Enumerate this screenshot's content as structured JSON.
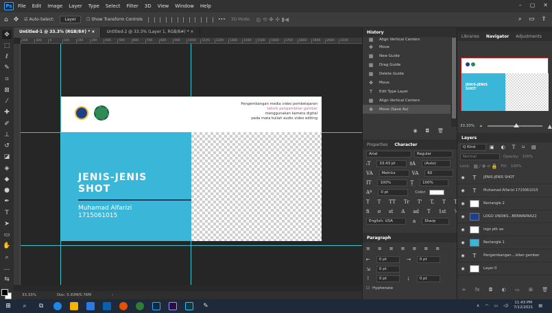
{
  "menubar": {
    "logo": "Ps",
    "items": [
      "File",
      "Edit",
      "Image",
      "Layer",
      "Type",
      "Select",
      "Filter",
      "3D",
      "View",
      "Window",
      "Help"
    ],
    "controls": [
      "–",
      "▢",
      "✕"
    ]
  },
  "options": {
    "auto_select_label": "Auto-Select:",
    "auto_select_value": "Layer",
    "transform_label": "Show Transform Controls",
    "mode_label": "3D Mode:"
  },
  "tabs": [
    {
      "label": "Untitled-1 @ 33.3% (RGB/8#) *",
      "close": "×"
    },
    {
      "label": "Untitled-2 @ 33.3% (Layer 1, RGB/8#) *",
      "close": "×"
    }
  ],
  "ruler_ticks": [
    "200",
    "300",
    "0",
    "100",
    "200",
    "300",
    "400",
    "500",
    "600",
    "700",
    "800",
    "900",
    "1000",
    "1100",
    "1200",
    "1300",
    "1400",
    "1500",
    "1600",
    "1700",
    "1800",
    "1900",
    "2000",
    "2100"
  ],
  "canvas": {
    "header_line1": "Pengembangan media video pembelajaran",
    "header_line2": "teknik pengambilan gambar",
    "header_line3": "menggunakan kamera digital",
    "header_line4": "pada mata kuliah audio video editing",
    "title_line1": "JENIS-JENIS",
    "title_line2": "SHOT",
    "name": "Muhamad Alfarizi",
    "nim": "1715061015",
    "colors": {
      "blue": "#3ab6d8",
      "navy": "#253b5a"
    }
  },
  "status": {
    "zoom": "33.33%",
    "doc": "Doc: 5.93M/5.76M"
  },
  "history": {
    "tab": "History",
    "items": [
      {
        "label": "Align Vertical Centers",
        "icon": "▦"
      },
      {
        "label": "Move",
        "icon": "✥"
      },
      {
        "label": "New Guide",
        "icon": "▦"
      },
      {
        "label": "Drag Guide",
        "icon": "▦"
      },
      {
        "label": "Delete Guide",
        "icon": "▦"
      },
      {
        "label": "Move",
        "icon": "✥"
      },
      {
        "label": "Edit Type Layer",
        "icon": "T"
      },
      {
        "label": "Align Vertical Centers",
        "icon": "▦"
      },
      {
        "label": "Move (Save As)",
        "icon": "✥"
      }
    ]
  },
  "character": {
    "tabs": [
      "Properties",
      "Character"
    ],
    "font": "Arial",
    "style": "Regular",
    "size": "33.43 pt",
    "leading": "(Auto)",
    "kerning": "Metrics",
    "tracking": "60",
    "vscale": "100%",
    "hscale": "100%",
    "baseline": "0 pt",
    "color_label": "Color:",
    "language": "English: USA",
    "aa_label": "a",
    "antialias": "Sharp",
    "glyphs_row1": [
      "T",
      "T",
      "TT",
      "Tr",
      "T'",
      "T,",
      "T",
      "T"
    ],
    "glyphs_row2": [
      "fi",
      "ơ",
      "st",
      "A",
      "ad",
      "T",
      "1st",
      "½"
    ]
  },
  "paragraph": {
    "tab": "Paragraph",
    "indent_left": "0 pt",
    "indent_right": "0 pt",
    "indent_first": "0 pt",
    "space_before": "0 pt",
    "space_after": "0 pt",
    "hyphenate": "Hyphenate"
  },
  "navigator": {
    "tabs": [
      "Libraries",
      "Navigator",
      "Adjustments"
    ],
    "zoom": "33.33%",
    "thumb_title": "JENIS-JENIS SHOT"
  },
  "layers": {
    "tab": "Layers",
    "kind": "Q Kind",
    "blend": "Normal",
    "opacity_label": "Opacity:",
    "opacity": "100%",
    "lock_label": "Lock:",
    "fill_label": "Fill:",
    "fill": "100%",
    "items": [
      {
        "name": "JENIS-JENIS SHOT",
        "thumb": "T",
        "kind": "t"
      },
      {
        "name": "Muhamad Alfarizi 1715061015",
        "thumb": "T",
        "kind": "t"
      },
      {
        "name": "Rectangle 2",
        "thumb": "",
        "kind": "white"
      },
      {
        "name": "LOGO UNDIKS...BERWARNA22",
        "thumb": "",
        "kind": "navy"
      },
      {
        "name": "logo ptk aa",
        "thumb": "",
        "kind": "white"
      },
      {
        "name": "Rectangle 1",
        "thumb": "",
        "kind": "blue"
      },
      {
        "name": "Pengembangan....bilan gambar",
        "thumb": "T",
        "kind": "t"
      },
      {
        "name": "Layer 0",
        "thumb": "",
        "kind": "white"
      }
    ]
  },
  "taskbar": {
    "time": "11:43 PM",
    "date": "7/12/2021"
  }
}
